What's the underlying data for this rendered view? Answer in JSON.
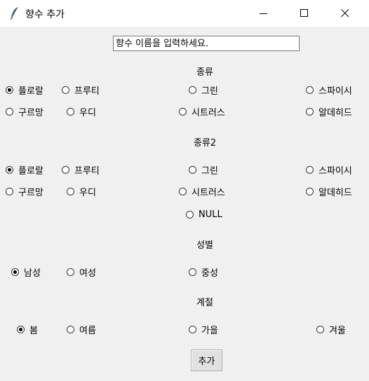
{
  "window": {
    "title": "향수 추가",
    "icon": "feather-icon",
    "controls": [
      "minimize-icon",
      "maximize-icon",
      "close-icon"
    ]
  },
  "name_input": {
    "placeholder": "향수 이름을 입력하세요."
  },
  "type1": {
    "label": "종류",
    "selected": "플로랄",
    "options": [
      "플로랄",
      "프루티",
      "그린",
      "스파이시",
      "구르망",
      "우디",
      "시트러스",
      "알데히드"
    ]
  },
  "type2": {
    "label": "종류2",
    "selected": "플로랄",
    "options": [
      "플로랄",
      "프루티",
      "그린",
      "스파이시",
      "구르망",
      "우디",
      "시트러스",
      "알데히드",
      "NULL"
    ]
  },
  "gender": {
    "label": "성별",
    "selected": "남성",
    "options": [
      "남성",
      "여성",
      "중성"
    ]
  },
  "season": {
    "label": "계절",
    "selected": "봄",
    "options": [
      "봄",
      "여름",
      "가을",
      "겨울"
    ]
  },
  "add_button": {
    "label": "추가"
  }
}
